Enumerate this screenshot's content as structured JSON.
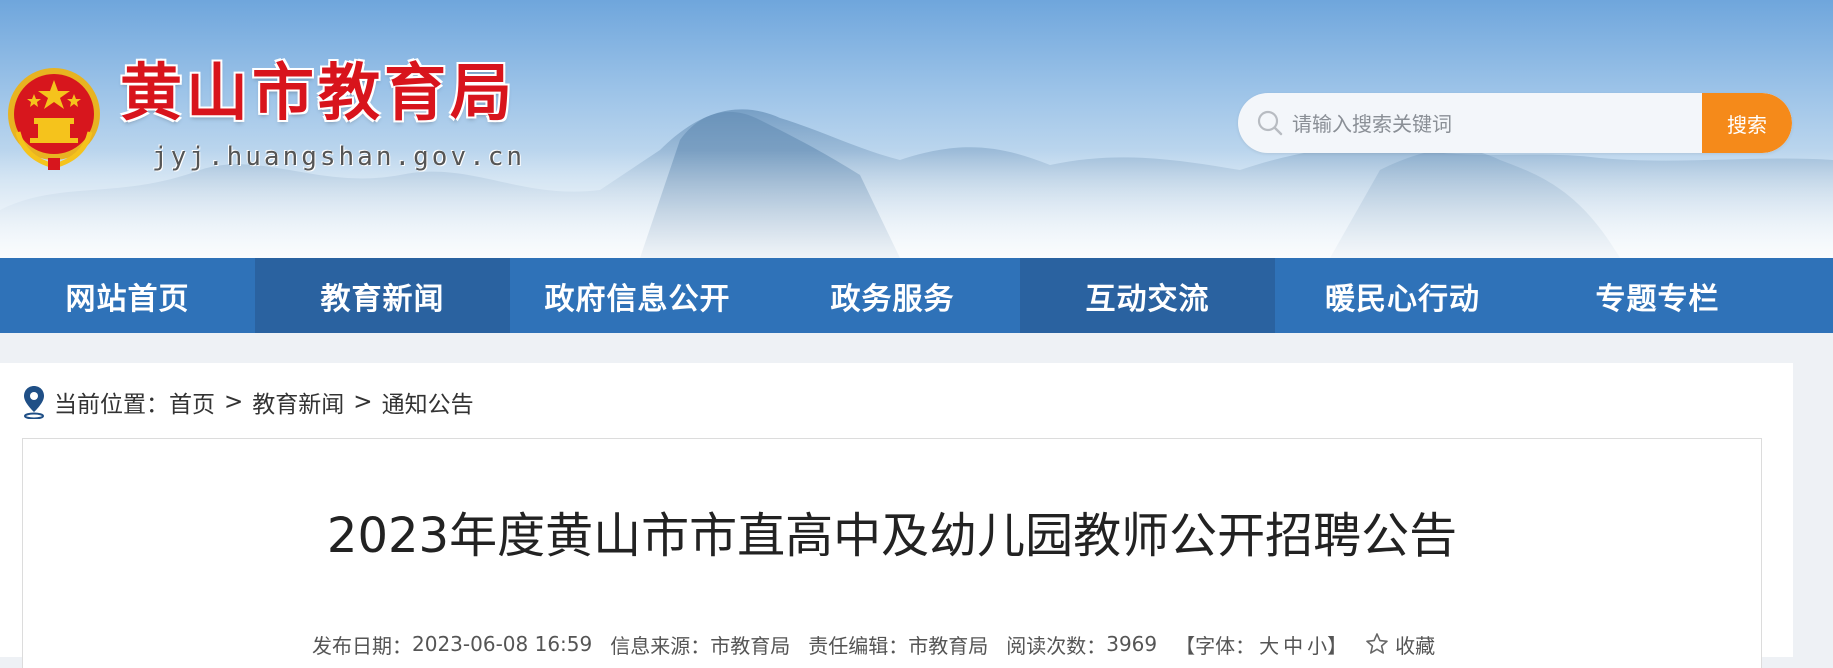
{
  "header": {
    "site_title": "黄山市教育局",
    "site_domain": "jyj.huangshan.gov.cn",
    "search_placeholder": "请输入搜索关键词",
    "search_button": "搜索"
  },
  "nav": {
    "items": [
      {
        "label": "网站首页"
      },
      {
        "label": "教育新闻"
      },
      {
        "label": "政府信息公开"
      },
      {
        "label": "政务服务"
      },
      {
        "label": "互动交流"
      },
      {
        "label": "暖民心行动"
      },
      {
        "label": "专题专栏"
      }
    ]
  },
  "breadcrumb": {
    "prefix": "当前位置：",
    "items": [
      "首页",
      "教育新闻",
      "通知公告"
    ],
    "separator": ">"
  },
  "article": {
    "title": "2023年度黄山市市直高中及幼儿园教师公开招聘公告",
    "publish_label": "发布日期：",
    "publish_date": "2023-06-08 16:59",
    "source_label": "信息来源：",
    "source": "市教育局",
    "editor_label": "责任编辑：",
    "editor": "市教育局",
    "views_label": "阅读次数：",
    "views": "3969",
    "font_prefix": "【字体：",
    "font_large": "大",
    "font_medium": "中",
    "font_small": "小",
    "font_suffix": "】",
    "favorite": "收藏"
  },
  "colors": {
    "nav_bg": "#2f72b8",
    "nav_alt_bg": "#2a62a0",
    "title_red": "#d8141c",
    "search_orange": "#f58a1a"
  }
}
